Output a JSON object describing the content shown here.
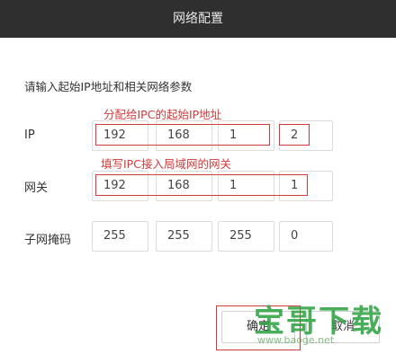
{
  "dialog": {
    "title": "网络配置"
  },
  "instruction": "请输入起始IP地址和相关网络参数",
  "annotations": {
    "ip_note": "分配给IPC的起始IP地址",
    "gateway_note": "填写IPC接入局域网的网关"
  },
  "rows": [
    {
      "label": "IP",
      "octets": [
        "192",
        "168",
        "1",
        "2"
      ]
    },
    {
      "label": "网关",
      "octets": [
        "192",
        "168",
        "1",
        "1"
      ]
    },
    {
      "label": "子网掩码",
      "octets": [
        "255",
        "255",
        "255",
        "0"
      ]
    }
  ],
  "buttons": {
    "ok": "确定",
    "cancel": "取消"
  },
  "watermark": {
    "text": "宝哥下载",
    "url": "www.baoge.net"
  },
  "colors": {
    "titlebar": "#2f2f2f",
    "highlight": "#d13b3b",
    "watermark": "#28a03c"
  }
}
